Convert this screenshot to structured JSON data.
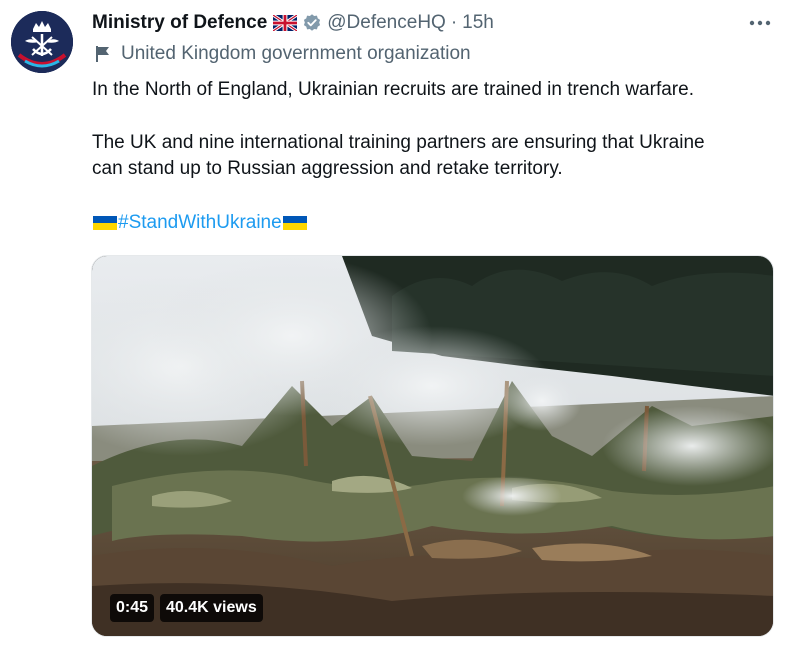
{
  "author": {
    "name": "Ministry of Defence",
    "handle": "@DefenceHQ",
    "separator": "·",
    "time": "15h",
    "affiliation": "United Kingdom government organization",
    "verified_color": "#829aab"
  },
  "tweet": {
    "line1": "In the North of England, Ukrainian recruits are trained in trench warfare.",
    "line2": "The UK and nine international training partners are ensuring that Ukraine",
    "line3": "can stand up to Russian aggression and retake territory.",
    "hashtag": "#StandWithUkraine"
  },
  "media": {
    "duration": "0:45",
    "views": "40.4K views"
  },
  "colors": {
    "link": "#1d9bf0",
    "secondary_text": "#536471",
    "ukraine_blue": "#0057b7",
    "ukraine_yellow": "#ffd700"
  }
}
